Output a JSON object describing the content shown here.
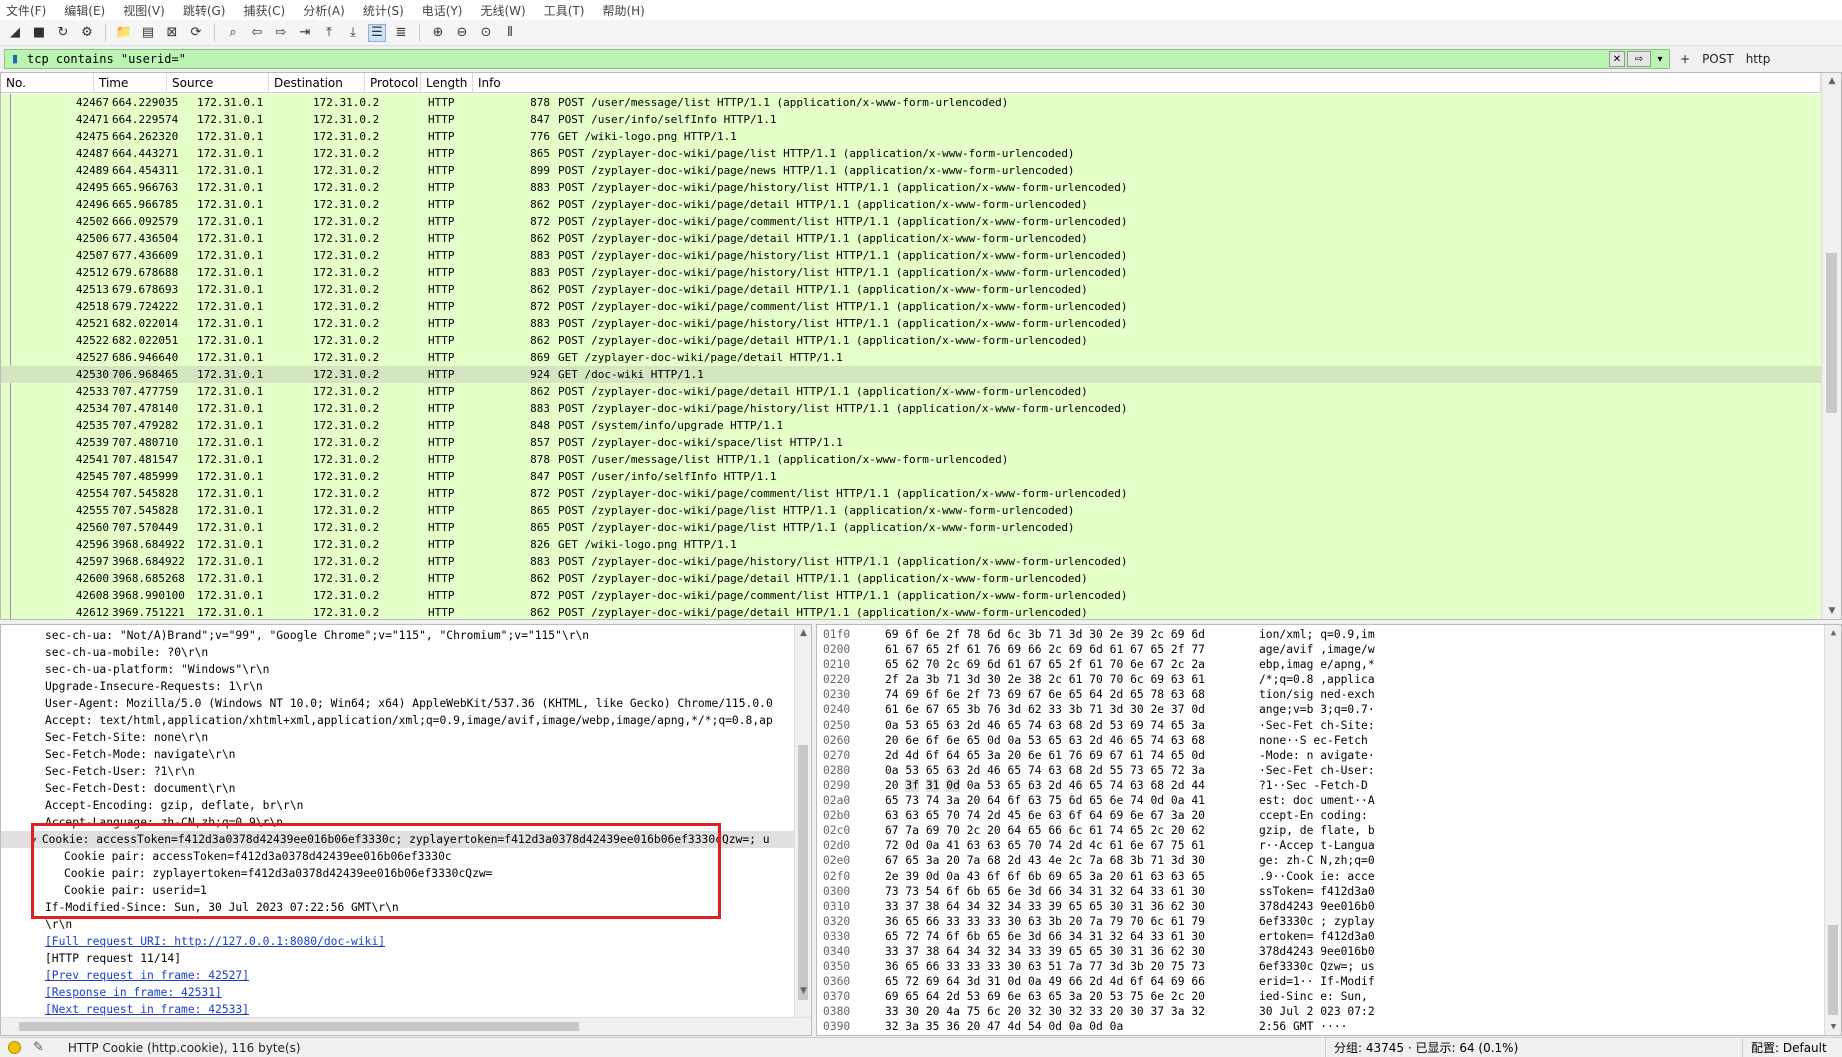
{
  "menu": [
    "文件(F)",
    "编辑(E)",
    "视图(V)",
    "跳转(G)",
    "捕获(C)",
    "分析(A)",
    "统计(S)",
    "电话(Y)",
    "无线(W)",
    "工具(T)",
    "帮助(H)"
  ],
  "toolbar": {
    "icons": [
      "shark-fin-start-icon",
      "stop-square-icon",
      "restart-shark-icon",
      "options-gear-icon",
      "open-folder-icon",
      "save-file-icon",
      "close-file-icon",
      "reload-icon",
      "find-magnifier-icon",
      "go-back-icon",
      "go-forward-icon",
      "go-to-packet-icon",
      "first-packet-icon",
      "last-packet-icon",
      "autoscroll-icon",
      "colorize-icon",
      "zoom-in-icon",
      "zoom-out-icon",
      "zoom-normal-icon",
      "resize-columns-icon"
    ]
  },
  "filter": {
    "value": "tcp contains \"userid=\"",
    "extra_buttons": [
      "+",
      "POST",
      "http"
    ]
  },
  "columns": [
    "No.",
    "Time",
    "Source",
    "Destination",
    "Protocol",
    "Length",
    "Info"
  ],
  "packets": [
    {
      "no": "42467",
      "time": "664.229035",
      "src": "172.31.0.1",
      "dst": "172.31.0.2",
      "proto": "HTTP",
      "len": "878",
      "info": "POST /user/message/list HTTP/1.1  (application/x-www-form-urlencoded)"
    },
    {
      "no": "42471",
      "time": "664.229574",
      "src": "172.31.0.1",
      "dst": "172.31.0.2",
      "proto": "HTTP",
      "len": "847",
      "info": "POST /user/info/selfInfo HTTP/1.1"
    },
    {
      "no": "42475",
      "time": "664.262320",
      "src": "172.31.0.1",
      "dst": "172.31.0.2",
      "proto": "HTTP",
      "len": "776",
      "info": "GET /wiki-logo.png HTTP/1.1"
    },
    {
      "no": "42487",
      "time": "664.443271",
      "src": "172.31.0.1",
      "dst": "172.31.0.2",
      "proto": "HTTP",
      "len": "865",
      "info": "POST /zyplayer-doc-wiki/page/list HTTP/1.1  (application/x-www-form-urlencoded)"
    },
    {
      "no": "42489",
      "time": "664.454311",
      "src": "172.31.0.1",
      "dst": "172.31.0.2",
      "proto": "HTTP",
      "len": "899",
      "info": "POST /zyplayer-doc-wiki/page/news HTTP/1.1  (application/x-www-form-urlencoded)"
    },
    {
      "no": "42495",
      "time": "665.966763",
      "src": "172.31.0.1",
      "dst": "172.31.0.2",
      "proto": "HTTP",
      "len": "883",
      "info": "POST /zyplayer-doc-wiki/page/history/list HTTP/1.1  (application/x-www-form-urlencoded)"
    },
    {
      "no": "42496",
      "time": "665.966785",
      "src": "172.31.0.1",
      "dst": "172.31.0.2",
      "proto": "HTTP",
      "len": "862",
      "info": "POST /zyplayer-doc-wiki/page/detail HTTP/1.1  (application/x-www-form-urlencoded)"
    },
    {
      "no": "42502",
      "time": "666.092579",
      "src": "172.31.0.1",
      "dst": "172.31.0.2",
      "proto": "HTTP",
      "len": "872",
      "info": "POST /zyplayer-doc-wiki/page/comment/list HTTP/1.1  (application/x-www-form-urlencoded)"
    },
    {
      "no": "42506",
      "time": "677.436504",
      "src": "172.31.0.1",
      "dst": "172.31.0.2",
      "proto": "HTTP",
      "len": "862",
      "info": "POST /zyplayer-doc-wiki/page/detail HTTP/1.1  (application/x-www-form-urlencoded)"
    },
    {
      "no": "42507",
      "time": "677.436609",
      "src": "172.31.0.1",
      "dst": "172.31.0.2",
      "proto": "HTTP",
      "len": "883",
      "info": "POST /zyplayer-doc-wiki/page/history/list HTTP/1.1  (application/x-www-form-urlencoded)"
    },
    {
      "no": "42512",
      "time": "679.678688",
      "src": "172.31.0.1",
      "dst": "172.31.0.2",
      "proto": "HTTP",
      "len": "883",
      "info": "POST /zyplayer-doc-wiki/page/history/list HTTP/1.1  (application/x-www-form-urlencoded)"
    },
    {
      "no": "42513",
      "time": "679.678693",
      "src": "172.31.0.1",
      "dst": "172.31.0.2",
      "proto": "HTTP",
      "len": "862",
      "info": "POST /zyplayer-doc-wiki/page/detail HTTP/1.1  (application/x-www-form-urlencoded)"
    },
    {
      "no": "42518",
      "time": "679.724222",
      "src": "172.31.0.1",
      "dst": "172.31.0.2",
      "proto": "HTTP",
      "len": "872",
      "info": "POST /zyplayer-doc-wiki/page/comment/list HTTP/1.1  (application/x-www-form-urlencoded)"
    },
    {
      "no": "42521",
      "time": "682.022014",
      "src": "172.31.0.1",
      "dst": "172.31.0.2",
      "proto": "HTTP",
      "len": "883",
      "info": "POST /zyplayer-doc-wiki/page/history/list HTTP/1.1  (application/x-www-form-urlencoded)"
    },
    {
      "no": "42522",
      "time": "682.022051",
      "src": "172.31.0.1",
      "dst": "172.31.0.2",
      "proto": "HTTP",
      "len": "862",
      "info": "POST /zyplayer-doc-wiki/page/detail HTTP/1.1  (application/x-www-form-urlencoded)"
    },
    {
      "no": "42527",
      "time": "686.946640",
      "src": "172.31.0.1",
      "dst": "172.31.0.2",
      "proto": "HTTP",
      "len": "869",
      "info": "GET /zyplayer-doc-wiki/page/detail HTTP/1.1"
    },
    {
      "no": "42530",
      "time": "706.968465",
      "src": "172.31.0.1",
      "dst": "172.31.0.2",
      "proto": "HTTP",
      "len": "924",
      "info": "GET /doc-wiki HTTP/1.1",
      "selected": true
    },
    {
      "no": "42533",
      "time": "707.477759",
      "src": "172.31.0.1",
      "dst": "172.31.0.2",
      "proto": "HTTP",
      "len": "862",
      "info": "POST /zyplayer-doc-wiki/page/detail HTTP/1.1  (application/x-www-form-urlencoded)"
    },
    {
      "no": "42534",
      "time": "707.478140",
      "src": "172.31.0.1",
      "dst": "172.31.0.2",
      "proto": "HTTP",
      "len": "883",
      "info": "POST /zyplayer-doc-wiki/page/history/list HTTP/1.1  (application/x-www-form-urlencoded)"
    },
    {
      "no": "42535",
      "time": "707.479282",
      "src": "172.31.0.1",
      "dst": "172.31.0.2",
      "proto": "HTTP",
      "len": "848",
      "info": "POST /system/info/upgrade HTTP/1.1"
    },
    {
      "no": "42539",
      "time": "707.480710",
      "src": "172.31.0.1",
      "dst": "172.31.0.2",
      "proto": "HTTP",
      "len": "857",
      "info": "POST /zyplayer-doc-wiki/space/list HTTP/1.1"
    },
    {
      "no": "42541",
      "time": "707.481547",
      "src": "172.31.0.1",
      "dst": "172.31.0.2",
      "proto": "HTTP",
      "len": "878",
      "info": "POST /user/message/list HTTP/1.1  (application/x-www-form-urlencoded)"
    },
    {
      "no": "42545",
      "time": "707.485999",
      "src": "172.31.0.1",
      "dst": "172.31.0.2",
      "proto": "HTTP",
      "len": "847",
      "info": "POST /user/info/selfInfo HTTP/1.1"
    },
    {
      "no": "42554",
      "time": "707.545828",
      "src": "172.31.0.1",
      "dst": "172.31.0.2",
      "proto": "HTTP",
      "len": "872",
      "info": "POST /zyplayer-doc-wiki/page/comment/list HTTP/1.1  (application/x-www-form-urlencoded)"
    },
    {
      "no": "42555",
      "time": "707.545828",
      "src": "172.31.0.1",
      "dst": "172.31.0.2",
      "proto": "HTTP",
      "len": "865",
      "info": "POST /zyplayer-doc-wiki/page/list HTTP/1.1  (application/x-www-form-urlencoded)"
    },
    {
      "no": "42560",
      "time": "707.570449",
      "src": "172.31.0.1",
      "dst": "172.31.0.2",
      "proto": "HTTP",
      "len": "865",
      "info": "POST /zyplayer-doc-wiki/page/list HTTP/1.1  (application/x-www-form-urlencoded)"
    },
    {
      "no": "42596",
      "time": "3968.684922",
      "src": "172.31.0.1",
      "dst": "172.31.0.2",
      "proto": "HTTP",
      "len": "826",
      "info": "GET /wiki-logo.png HTTP/1.1"
    },
    {
      "no": "42597",
      "time": "3968.684922",
      "src": "172.31.0.1",
      "dst": "172.31.0.2",
      "proto": "HTTP",
      "len": "883",
      "info": "POST /zyplayer-doc-wiki/page/history/list HTTP/1.1  (application/x-www-form-urlencoded)"
    },
    {
      "no": "42600",
      "time": "3968.685268",
      "src": "172.31.0.1",
      "dst": "172.31.0.2",
      "proto": "HTTP",
      "len": "862",
      "info": "POST /zyplayer-doc-wiki/page/detail HTTP/1.1  (application/x-www-form-urlencoded)"
    },
    {
      "no": "42608",
      "time": "3968.990100",
      "src": "172.31.0.1",
      "dst": "172.31.0.2",
      "proto": "HTTP",
      "len": "872",
      "info": "POST /zyplayer-doc-wiki/page/comment/list HTTP/1.1  (application/x-www-form-urlencoded)"
    },
    {
      "no": "42612",
      "time": "3969.751221",
      "src": "172.31.0.1",
      "dst": "172.31.0.2",
      "proto": "HTTP",
      "len": "862",
      "info": "POST /zyplayer-doc-wiki/page/detail HTTP/1.1  (application/x-www-form-urlencoded)"
    }
  ],
  "details": [
    {
      "text": "sec-ch-ua: \"Not/A)Brand\";v=\"99\", \"Google Chrome\";v=\"115\", \"Chromium\";v=\"115\"\\r\\n"
    },
    {
      "text": "sec-ch-ua-mobile: ?0\\r\\n"
    },
    {
      "text": "sec-ch-ua-platform: \"Windows\"\\r\\n"
    },
    {
      "text": "Upgrade-Insecure-Requests: 1\\r\\n"
    },
    {
      "text": "User-Agent: Mozilla/5.0 (Windows NT 10.0; Win64; x64) AppleWebKit/537.36 (KHTML, like Gecko) Chrome/115.0.0"
    },
    {
      "text": "Accept: text/html,application/xhtml+xml,application/xml;q=0.9,image/avif,image/webp,image/apng,*/*;q=0.8,ap"
    },
    {
      "text": "Sec-Fetch-Site: none\\r\\n"
    },
    {
      "text": "Sec-Fetch-Mode: navigate\\r\\n"
    },
    {
      "text": "Sec-Fetch-User: ?1\\r\\n"
    },
    {
      "text": "Sec-Fetch-Dest: document\\r\\n"
    },
    {
      "text": "Accept-Encoding: gzip, deflate, br\\r\\n"
    },
    {
      "text": "Accept-Language: zh-CN,zh;q=0.9\\r\\n"
    },
    {
      "text": "Cookie: accessToken=f412d3a0378d42439ee016b06ef3330c; zyplayertoken=f412d3a0378d42439ee016b06ef3330cQzw=; u",
      "selected": true,
      "expander": "▾"
    },
    {
      "text": "Cookie pair: accessToken=f412d3a0378d42439ee016b06ef3330c",
      "indent": true
    },
    {
      "text": "Cookie pair: zyplayertoken=f412d3a0378d42439ee016b06ef3330cQzw=",
      "indent": true
    },
    {
      "text": "Cookie pair: userid=1",
      "indent": true
    },
    {
      "text": "If-Modified-Since: Sun, 30 Jul 2023 07:22:56 GMT\\r\\n"
    },
    {
      "text": "\\r\\n"
    },
    {
      "text": "[Full request URI: http://127.0.0.1:8080/doc-wiki]",
      "link": true
    },
    {
      "text": "[HTTP request 11/14]"
    },
    {
      "text": "[Prev request in frame: 42527]",
      "link": true
    },
    {
      "text": "[Response in frame: 42531]",
      "link": true
    },
    {
      "text": "[Next request in frame: 42533]",
      "link": true
    }
  ],
  "bytes": [
    {
      "off": "01f0",
      "hex": [
        "69",
        "6f",
        "6e",
        "2f",
        "78",
        "6d",
        "6c",
        "3b",
        "71",
        "3d",
        "30",
        "2e",
        "39",
        "2c",
        "69",
        "6d"
      ],
      "ascii": "ion/xml; q=0.9,im"
    },
    {
      "off": "0200",
      "hex": [
        "61",
        "67",
        "65",
        "2f",
        "61",
        "76",
        "69",
        "66",
        "2c",
        "69",
        "6d",
        "61",
        "67",
        "65",
        "2f",
        "77"
      ],
      "ascii": "age/avif ,image/w"
    },
    {
      "off": "0210",
      "hex": [
        "65",
        "62",
        "70",
        "2c",
        "69",
        "6d",
        "61",
        "67",
        "65",
        "2f",
        "61",
        "70",
        "6e",
        "67",
        "2c",
        "2a"
      ],
      "ascii": "ebp,imag e/apng,*"
    },
    {
      "off": "0220",
      "hex": [
        "2f",
        "2a",
        "3b",
        "71",
        "3d",
        "30",
        "2e",
        "38",
        "2c",
        "61",
        "70",
        "70",
        "6c",
        "69",
        "63",
        "61"
      ],
      "ascii": "/*;q=0.8 ,applica"
    },
    {
      "off": "0230",
      "hex": [
        "74",
        "69",
        "6f",
        "6e",
        "2f",
        "73",
        "69",
        "67",
        "6e",
        "65",
        "64",
        "2d",
        "65",
        "78",
        "63",
        "68"
      ],
      "ascii": "tion/sig ned-exch"
    },
    {
      "off": "0240",
      "hex": [
        "61",
        "6e",
        "67",
        "65",
        "3b",
        "76",
        "3d",
        "62",
        "33",
        "3b",
        "71",
        "3d",
        "30",
        "2e",
        "37",
        "0d"
      ],
      "ascii": "ange;v=b 3;q=0.7·"
    },
    {
      "off": "0250",
      "hex": [
        "0a",
        "53",
        "65",
        "63",
        "2d",
        "46",
        "65",
        "74",
        "63",
        "68",
        "2d",
        "53",
        "69",
        "74",
        "65",
        "3a"
      ],
      "ascii": "·Sec-Fet ch-Site:"
    },
    {
      "off": "0260",
      "hex": [
        "20",
        "6e",
        "6f",
        "6e",
        "65",
        "0d",
        "0a",
        "53",
        "65",
        "63",
        "2d",
        "46",
        "65",
        "74",
        "63",
        "68"
      ],
      "ascii": " none··S ec-Fetch"
    },
    {
      "off": "0270",
      "hex": [
        "2d",
        "4d",
        "6f",
        "64",
        "65",
        "3a",
        "20",
        "6e",
        "61",
        "76",
        "69",
        "67",
        "61",
        "74",
        "65",
        "0d"
      ],
      "ascii": "-Mode: n avigate·"
    },
    {
      "off": "0280",
      "hex": [
        "0a",
        "53",
        "65",
        "63",
        "2d",
        "46",
        "65",
        "74",
        "63",
        "68",
        "2d",
        "55",
        "73",
        "65",
        "72",
        "3a"
      ],
      "ascii": "·Sec-Fet ch-User:"
    },
    {
      "off": "0290",
      "hex": [
        "20",
        "3f",
        "31",
        "0d",
        "0a",
        "53",
        "65",
        "63",
        "2d",
        "46",
        "65",
        "74",
        "63",
        "68",
        "2d",
        "44"
      ],
      "ascii": " ?1··Sec -Fetch-D",
      "hl": [
        1,
        2,
        3
      ]
    },
    {
      "off": "02a0",
      "hex": [
        "65",
        "73",
        "74",
        "3a",
        "20",
        "64",
        "6f",
        "63",
        "75",
        "6d",
        "65",
        "6e",
        "74",
        "0d",
        "0a",
        "41"
      ],
      "ascii": "est: doc ument··A"
    },
    {
      "off": "02b0",
      "hex": [
        "63",
        "63",
        "65",
        "70",
        "74",
        "2d",
        "45",
        "6e",
        "63",
        "6f",
        "64",
        "69",
        "6e",
        "67",
        "3a",
        "20"
      ],
      "ascii": "ccept-En coding: "
    },
    {
      "off": "02c0",
      "hex": [
        "67",
        "7a",
        "69",
        "70",
        "2c",
        "20",
        "64",
        "65",
        "66",
        "6c",
        "61",
        "74",
        "65",
        "2c",
        "20",
        "62"
      ],
      "ascii": "gzip, de flate, b"
    },
    {
      "off": "02d0",
      "hex": [
        "72",
        "0d",
        "0a",
        "41",
        "63",
        "63",
        "65",
        "70",
        "74",
        "2d",
        "4c",
        "61",
        "6e",
        "67",
        "75",
        "61"
      ],
      "ascii": "r··Accep t-Langua"
    },
    {
      "off": "02e0",
      "hex": [
        "67",
        "65",
        "3a",
        "20",
        "7a",
        "68",
        "2d",
        "43",
        "4e",
        "2c",
        "7a",
        "68",
        "3b",
        "71",
        "3d",
        "30"
      ],
      "ascii": "ge: zh-C N,zh;q=0"
    },
    {
      "off": "02f0",
      "hex": [
        "2e",
        "39",
        "0d",
        "0a",
        "43",
        "6f",
        "6f",
        "6b",
        "69",
        "65",
        "3a",
        "20",
        "61",
        "63",
        "63",
        "65"
      ],
      "ascii": ".9··Cook ie: acce"
    },
    {
      "off": "0300",
      "hex": [
        "73",
        "73",
        "54",
        "6f",
        "6b",
        "65",
        "6e",
        "3d",
        "66",
        "34",
        "31",
        "32",
        "64",
        "33",
        "61",
        "30"
      ],
      "ascii": "ssToken= f412d3a0"
    },
    {
      "off": "0310",
      "hex": [
        "33",
        "37",
        "38",
        "64",
        "34",
        "32",
        "34",
        "33",
        "39",
        "65",
        "65",
        "30",
        "31",
        "36",
        "62",
        "30"
      ],
      "ascii": "378d4243 9ee016b0"
    },
    {
      "off": "0320",
      "hex": [
        "36",
        "65",
        "66",
        "33",
        "33",
        "33",
        "30",
        "63",
        "3b",
        "20",
        "7a",
        "79",
        "70",
        "6c",
        "61",
        "79"
      ],
      "ascii": "6ef3330c ; zyplay"
    },
    {
      "off": "0330",
      "hex": [
        "65",
        "72",
        "74",
        "6f",
        "6b",
        "65",
        "6e",
        "3d",
        "66",
        "34",
        "31",
        "32",
        "64",
        "33",
        "61",
        "30"
      ],
      "ascii": "ertoken= f412d3a0"
    },
    {
      "off": "0340",
      "hex": [
        "33",
        "37",
        "38",
        "64",
        "34",
        "32",
        "34",
        "33",
        "39",
        "65",
        "65",
        "30",
        "31",
        "36",
        "62",
        "30"
      ],
      "ascii": "378d4243 9ee016b0"
    },
    {
      "off": "0350",
      "hex": [
        "36",
        "65",
        "66",
        "33",
        "33",
        "33",
        "30",
        "63",
        "51",
        "7a",
        "77",
        "3d",
        "3b",
        "20",
        "75",
        "73"
      ],
      "ascii": "6ef3330c Qzw=; us"
    },
    {
      "off": "0360",
      "hex": [
        "65",
        "72",
        "69",
        "64",
        "3d",
        "31",
        "0d",
        "0a",
        "49",
        "66",
        "2d",
        "4d",
        "6f",
        "64",
        "69",
        "66"
      ],
      "ascii": "erid=1·· If-Modif"
    },
    {
      "off": "0370",
      "hex": [
        "69",
        "65",
        "64",
        "2d",
        "53",
        "69",
        "6e",
        "63",
        "65",
        "3a",
        "20",
        "53",
        "75",
        "6e",
        "2c",
        "20"
      ],
      "ascii": "ied-Sinc e: Sun, "
    },
    {
      "off": "0380",
      "hex": [
        "33",
        "30",
        "20",
        "4a",
        "75",
        "6c",
        "20",
        "32",
        "30",
        "32",
        "33",
        "20",
        "30",
        "37",
        "3a",
        "32"
      ],
      "ascii": "30 Jul 2 023 07:2"
    },
    {
      "off": "0390",
      "hex": [
        "32",
        "3a",
        "35",
        "36",
        "20",
        "47",
        "4d",
        "54",
        "0d",
        "0a",
        "0d",
        "0a"
      ],
      "ascii": "2:56 GMT ····"
    }
  ],
  "status": {
    "field": "HTTP Cookie (http.cookie), 116 byte(s)",
    "packets": "分组: 43745 · 已显示: 64 (0.1%)",
    "profile": "配置: Default"
  }
}
